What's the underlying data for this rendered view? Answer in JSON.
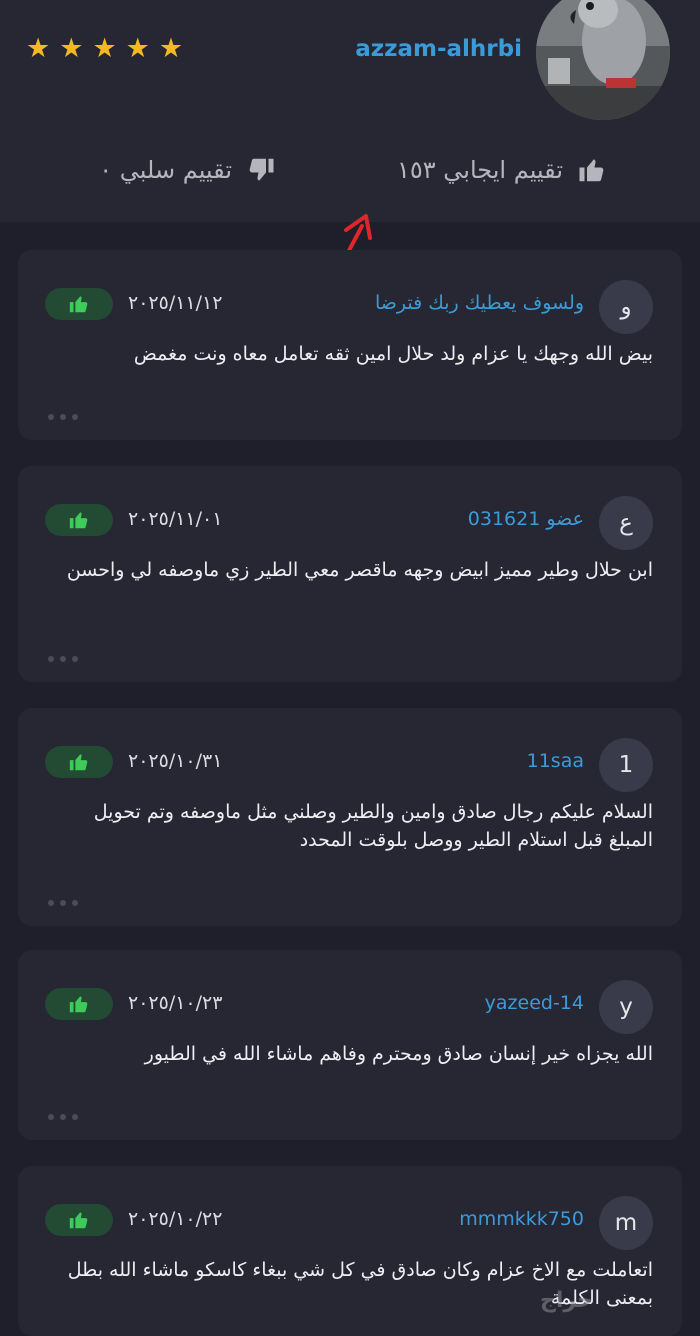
{
  "header": {
    "username": "azzam-alhrbi",
    "stars": [
      "★",
      "★",
      "★",
      "★",
      "★"
    ],
    "star_color": "#f5b820",
    "avatar_icon": "parrot-photo",
    "positive_label": "تقييم ايجابي ١٥٣",
    "negative_label": "تقييم سلبي ٠"
  },
  "reviews": [
    {
      "initial": "و",
      "author": "ولسوف يعطيك ربك فترضا",
      "date": "٢٠٢٥/١١/١٢",
      "comment": "بيض الله وجهك يا عزام ولد حلال امين ثقه تعامل معاه ونت مغمض"
    },
    {
      "initial": "ع",
      "author": "عضو 031621",
      "date": "٢٠٢٥/١١/٠١",
      "comment": "ابن حلال وطير مميز ابيض وجهه ماقصر معي الطير زي ماوصفه لي واحسن"
    },
    {
      "initial": "1",
      "author": "11saa",
      "date": "٢٠٢٥/١٠/٣١",
      "comment": "السلام عليكم رجال صادق وامين والطير وصلني مثل ماوصفه وتم تحويل المبلغ قبل استلام الطير ووصل بلوقت المحدد"
    },
    {
      "initial": "y",
      "author": "yazeed-14",
      "date": "٢٠٢٥/١٠/٢٣",
      "comment": "الله يجزاه خير إنسان صادق ومحترم وفاهم ماشاء الله في الطيور"
    },
    {
      "initial": "m",
      "author": "mmmkkk750",
      "date": "٢٠٢٥/١٠/٢٢",
      "comment": "اتعاملت مع الاخ عزام وكان صادق في كل شي ببغاء كاسكو ماشاء الله بطل بمعنى الكلمة"
    }
  ],
  "watermark": "حراج",
  "colors": {
    "accent_blue": "#3b9bd9",
    "like_green": "#3ecb5a",
    "background": "#1e1f2a",
    "card": "#262733"
  }
}
